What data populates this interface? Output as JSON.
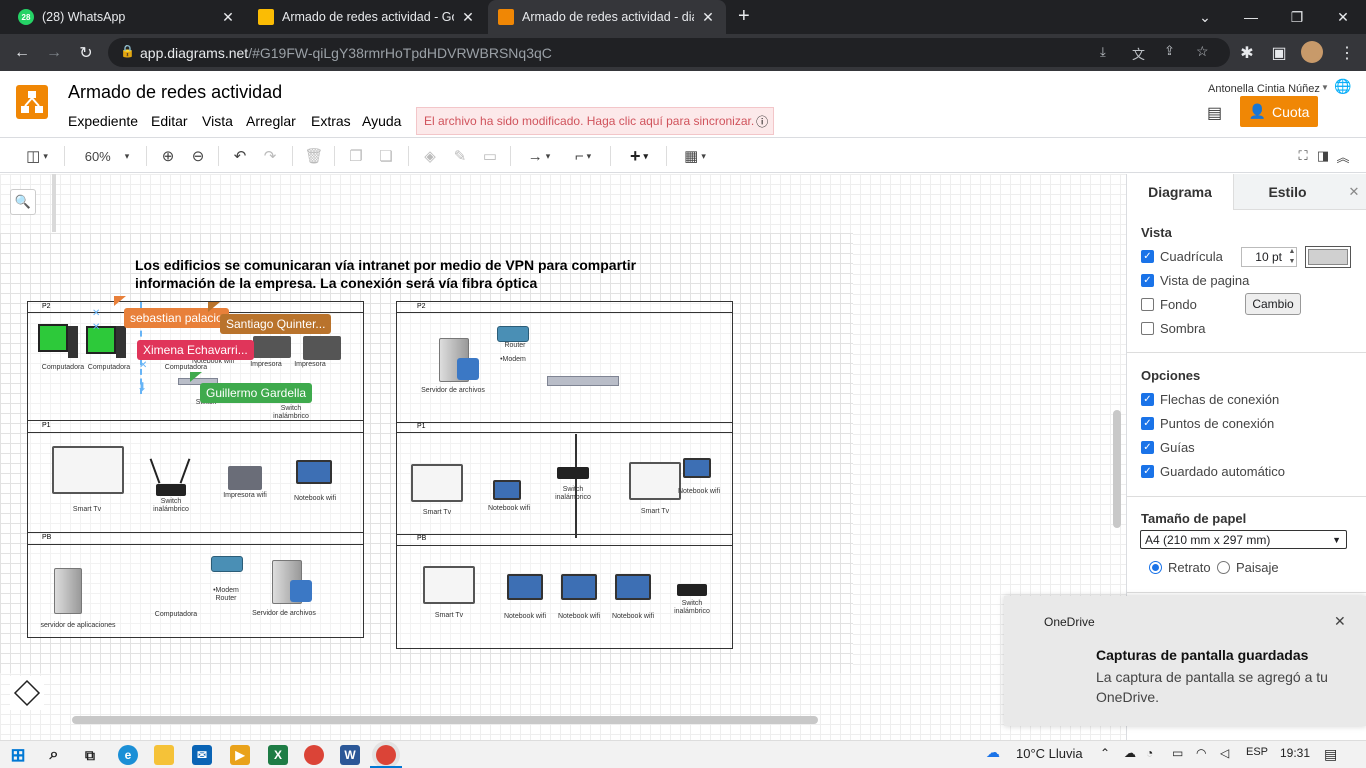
{
  "browser": {
    "tabs": [
      {
        "title": "(28) WhatsApp",
        "badge": "28",
        "color": "#25d366"
      },
      {
        "title": "Armado de redes actividad - Goo",
        "color": "#fbbc04"
      },
      {
        "title": "Armado de redes actividad - diag",
        "color": "#f08705"
      }
    ],
    "new_tab": "+",
    "url_host": "app.diagrams.net",
    "url_path": "/#G19FW-qiLgY38rmrHoTpdHDVRWBRSNq3qC"
  },
  "app": {
    "title": "Armado de redes actividad",
    "menus": [
      "Expediente",
      "Editar",
      "Vista",
      "Arreglar",
      "Extras",
      "Ayuda"
    ],
    "sync_message": "El archivo ha sido modificado. Haga clic aquí para sincronizar.",
    "user": "Antonella Cintia Núñez",
    "share_label": "Cuota",
    "zoom": "60%"
  },
  "diagram": {
    "heading": "Los edificios se comunicaran vía intranet por medio de VPN para compartir información de la empresa. La conexión será vía fibra óptica",
    "left": {
      "p2": {
        "floor": "P2",
        "labels": [
          "Computadora",
          "Computadora",
          "Computadora",
          "Notebook wifi",
          "Impresora",
          "Impresora",
          "Switch",
          "Switch inalámbrico"
        ]
      },
      "p1": {
        "floor": "P1",
        "labels": [
          "Smart Tv",
          "Switch inalámbrico",
          "Impresora wifi",
          "Notebook wifi"
        ]
      },
      "pb": {
        "floor": "PB",
        "labels": [
          "servidor de aplicaciones",
          "Computadora",
          "•Modem Router",
          "Servidor de archivos"
        ]
      }
    },
    "right": {
      "p2": {
        "floor": "P2",
        "labels": [
          "Servidor de archivos",
          "Router",
          "•Modem"
        ]
      },
      "p1": {
        "floor": "P1",
        "labels": [
          "Smart Tv",
          "Notebook wifi",
          "Switch inalámbrico",
          "Smart Tv",
          "Notebook wifi"
        ]
      },
      "pb": {
        "floor": "PB",
        "labels": [
          "Smart Tv",
          "Notebook wifi",
          "Notebook wifi",
          "Notebook wifi",
          "Switch inalámbrico"
        ]
      }
    },
    "collaborators": [
      {
        "name": "sebastian palacio",
        "color": "#e8803a"
      },
      {
        "name": "Santiago Quinter...",
        "color": "#b9732c"
      },
      {
        "name": "Ximena Echavarri...",
        "color": "#e0355a"
      },
      {
        "name": "Guillermo Gardella",
        "color": "#3faa4d"
      }
    ]
  },
  "panel": {
    "tabs": [
      "Diagrama",
      "Estilo"
    ],
    "vista_title": "Vista",
    "grid_label": "Cuadrícula",
    "grid_size": "10 pt",
    "vista_options": [
      {
        "label": "Vista de pagina",
        "checked": true
      },
      {
        "label": "Fondo",
        "checked": false
      },
      {
        "label": "Sombra",
        "checked": false
      }
    ],
    "fondo_button": "Cambio",
    "opciones_title": "Opciones",
    "opciones": [
      "Flechas de conexión",
      "Puntos de conexión",
      "Guías",
      "Guardado automático"
    ],
    "paper_title": "Tamaño de papel",
    "paper_value": "A4 (210 mm x 297 mm)",
    "orientation": [
      "Retrato",
      "Paisaje"
    ]
  },
  "toast": {
    "app": "OneDrive",
    "title": "Capturas de pantalla guardadas",
    "body": "La captura de pantalla se agregó a tu OneDrive."
  },
  "taskbar": {
    "weather": "10°C  Lluvia",
    "lang": "ESP",
    "time": "19:31"
  }
}
